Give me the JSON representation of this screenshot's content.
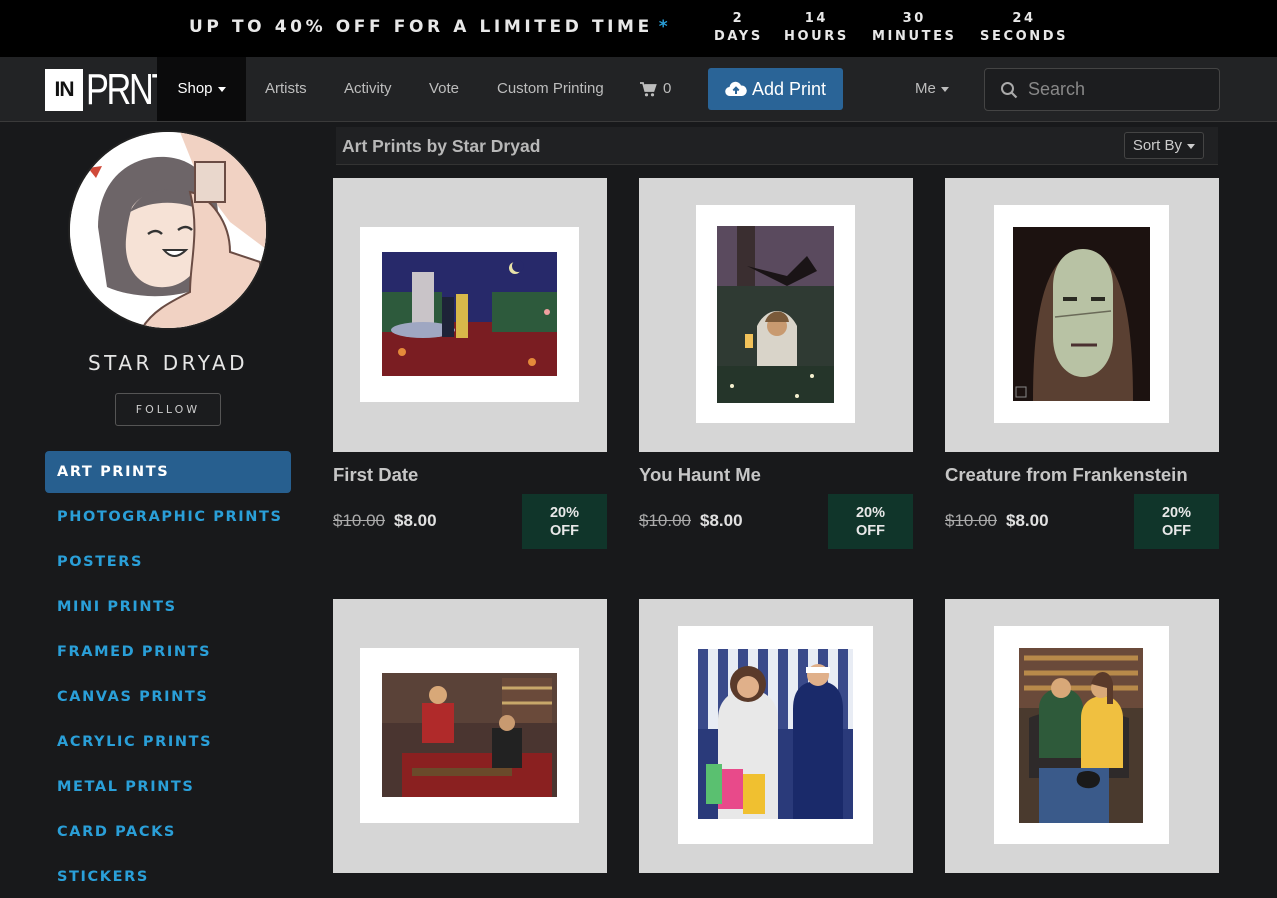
{
  "promo": {
    "text": "UP TO 40% OFF FOR A LIMITED TIME",
    "star": "*",
    "countdown": [
      {
        "num": "2",
        "unit": "DAYS"
      },
      {
        "num": "14",
        "unit": "HOURS"
      },
      {
        "num": "30",
        "unit": "MINUTES"
      },
      {
        "num": "24",
        "unit": "SECONDS"
      }
    ]
  },
  "nav": {
    "logo_in": "IN",
    "logo_prnt": "PRNT",
    "shop": "Shop",
    "artists": "Artists",
    "activity": "Activity",
    "vote": "Vote",
    "custom_printing": "Custom Printing",
    "cart_count": "0",
    "add_print": "Add Print",
    "me": "Me",
    "search_placeholder": "Search"
  },
  "sidebar": {
    "artist_name": "STAR DRYAD",
    "follow": "FOLLOW",
    "items": [
      {
        "label": "ART PRINTS",
        "active": true
      },
      {
        "label": "PHOTOGRAPHIC PRINTS"
      },
      {
        "label": "POSTERS"
      },
      {
        "label": "MINI PRINTS"
      },
      {
        "label": "FRAMED PRINTS"
      },
      {
        "label": "CANVAS PRINTS"
      },
      {
        "label": "ACRYLIC PRINTS"
      },
      {
        "label": "METAL PRINTS"
      },
      {
        "label": "CARD PACKS"
      },
      {
        "label": "STICKERS"
      }
    ]
  },
  "main": {
    "title": "Art Prints by Star Dryad",
    "sort_by": "Sort By",
    "products": [
      {
        "title": "First Date",
        "old_price": "$10.00",
        "price": "$8.00",
        "badge_line1": "20%",
        "badge_line2": "OFF"
      },
      {
        "title": "You Haunt Me",
        "old_price": "$10.00",
        "price": "$8.00",
        "badge_line1": "20%",
        "badge_line2": "OFF"
      },
      {
        "title": "Creature from Frankenstein",
        "old_price": "$10.00",
        "price": "$8.00",
        "badge_line1": "20%",
        "badge_line2": "OFF"
      },
      {
        "title": "",
        "old_price": "",
        "price": "",
        "badge_line1": "",
        "badge_line2": ""
      },
      {
        "title": "",
        "old_price": "",
        "price": "",
        "badge_line1": "",
        "badge_line2": ""
      },
      {
        "title": "",
        "old_price": "",
        "price": "",
        "badge_line1": "",
        "badge_line2": ""
      }
    ]
  },
  "colors": {
    "accent": "#2a9fd8",
    "active_side": "#275f8f",
    "add_print": "#2a6497",
    "badge": "#10352a"
  }
}
